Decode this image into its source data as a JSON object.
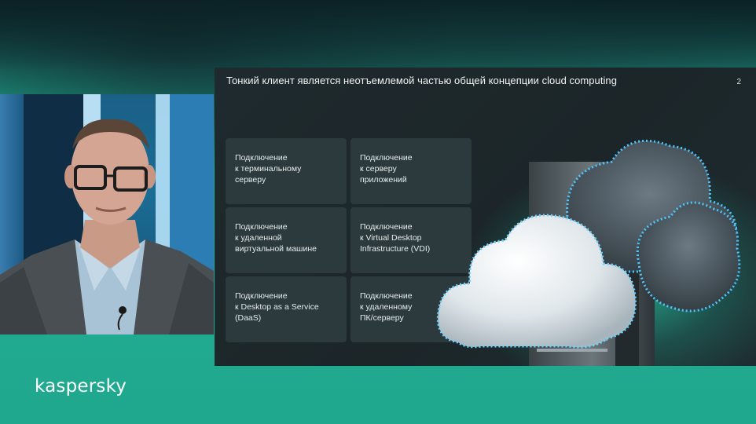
{
  "slide": {
    "title": "Тонкий клиент является неотъемлемой частью общей концепции cloud computing",
    "page_number": "2",
    "cards": [
      {
        "text": "Подключение\nк терминальному\nсерверу"
      },
      {
        "text": "Подключение\nк серверу\nприложений"
      },
      {
        "text": "Подключение\nк удаленной\nвиртуальной машине"
      },
      {
        "text": "Подключение\nк Virtual Desktop\nInfrastructure (VDI)"
      },
      {
        "text": "Подключение\nк Desktop as a Service\n(DaaS)"
      },
      {
        "text": "Подключение\nк удаленному\nПК/серверу"
      }
    ]
  },
  "brand": {
    "logo_text": "kaspersky"
  },
  "colors": {
    "brand_teal": "#1fa88e",
    "slide_bg": "#1f2a2e",
    "card_bg": "#2c3a3d",
    "text_light": "#e6ecec"
  },
  "illustration": {
    "icon": "cloud-server-icon"
  }
}
